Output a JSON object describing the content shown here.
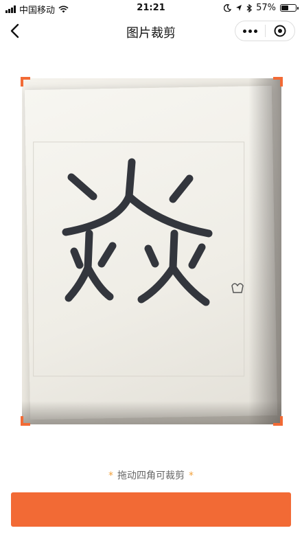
{
  "status_bar": {
    "carrier": "中国移动",
    "time": "21:21",
    "battery_percent": "57%",
    "battery_level": 0.57
  },
  "nav": {
    "title": "图片裁剪"
  },
  "photo": {
    "glyph": "焱"
  },
  "hint": {
    "text": "拖动四角可裁剪",
    "star": "*"
  },
  "colors": {
    "accent": "#f26a35",
    "hint_star": "#f3a03a"
  },
  "icons": [
    "signal-icon",
    "wifi-icon",
    "moon-icon",
    "location-icon",
    "bluetooth-icon",
    "battery-icon",
    "back-icon",
    "more-icon",
    "close-icon"
  ]
}
